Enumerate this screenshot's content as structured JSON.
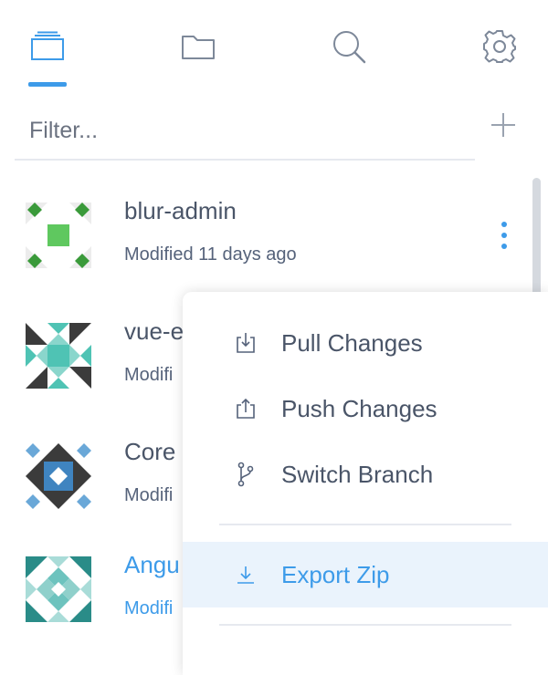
{
  "colors": {
    "accent": "#3d9be9",
    "text": "#4a5568",
    "muted": "#55627a",
    "selected_bg": "#eaf3fc"
  },
  "tabs": [
    {
      "icon": "cards-icon",
      "active": true
    },
    {
      "icon": "folder-icon",
      "active": false
    },
    {
      "icon": "search-icon",
      "active": false
    },
    {
      "icon": "gear-icon",
      "active": false
    }
  ],
  "filter": {
    "placeholder": "Filter...",
    "value": ""
  },
  "add_icon": "plus-icon",
  "projects": [
    {
      "name": "blur-admin",
      "meta": "Modified 11 days ago",
      "active": false
    },
    {
      "name": "vue-e",
      "meta": "Modifi",
      "active": false
    },
    {
      "name": "Core",
      "meta": "Modifi",
      "active": false
    },
    {
      "name": "Angu",
      "meta": "Modifi",
      "active": true
    }
  ],
  "more_icon": "kebab-menu-icon",
  "context_menu": {
    "items": [
      {
        "label": "Pull Changes",
        "icon": "download-box-icon"
      },
      {
        "label": "Push Changes",
        "icon": "upload-box-icon"
      },
      {
        "label": "Switch Branch",
        "icon": "git-branch-icon"
      },
      {
        "label": "Export Zip",
        "icon": "download-icon",
        "selected": true
      }
    ]
  }
}
